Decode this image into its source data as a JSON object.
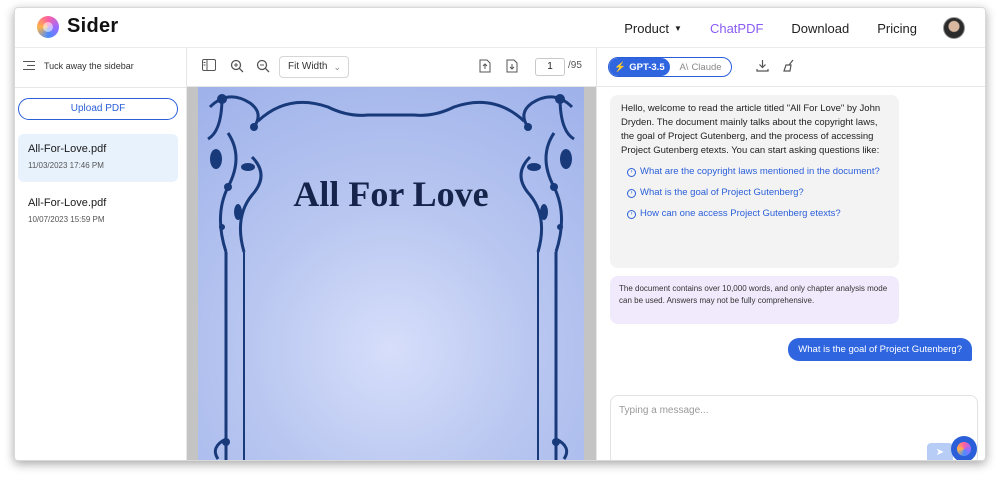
{
  "header": {
    "app_name": "Sider",
    "nav": [
      {
        "label": "Product",
        "has_caret": true
      },
      {
        "label": "ChatPDF",
        "active": true
      },
      {
        "label": "Download"
      },
      {
        "label": "Pricing"
      }
    ],
    "colors": {
      "active_nav": "#8a5cf6"
    }
  },
  "sidebar": {
    "tuck_label": "Tuck away the sidebar",
    "upload_label": "Upload PDF",
    "files": [
      {
        "name": "All-For-Love.pdf",
        "date": "11/03/2023 17:46 PM",
        "active": true
      },
      {
        "name": "All-For-Love.pdf",
        "date": "10/07/2023 15:59 PM",
        "active": false
      }
    ]
  },
  "viewer": {
    "zoom_mode": "Fit Width",
    "page_current": "1",
    "page_total": "/95",
    "document_title": "All For Love"
  },
  "chat": {
    "models": {
      "gpt": "GPT-3.5",
      "claude": "Claude",
      "selected": "gpt"
    },
    "welcome": "Hello, welcome to read the article titled \"All For Love\" by John Dryden. The document mainly talks about the copyright laws, the goal of Project Gutenberg, and the process of accessing Project Gutenberg etexts. You can start asking questions like:",
    "suggestions": [
      "What are the copyright laws mentioned in the document?",
      "What is the goal of Project Gutenberg?",
      "How can one access Project Gutenberg etexts?"
    ],
    "notice": "The document contains over 10,000 words, and only chapter analysis mode can be used. Answers may not be fully comprehensive.",
    "user_message": "What is the goal of Project Gutenberg?",
    "input_placeholder": "Typing a message...",
    "colors": {
      "accent": "#2f66e0",
      "notice_bg": "#f1eafc"
    }
  }
}
